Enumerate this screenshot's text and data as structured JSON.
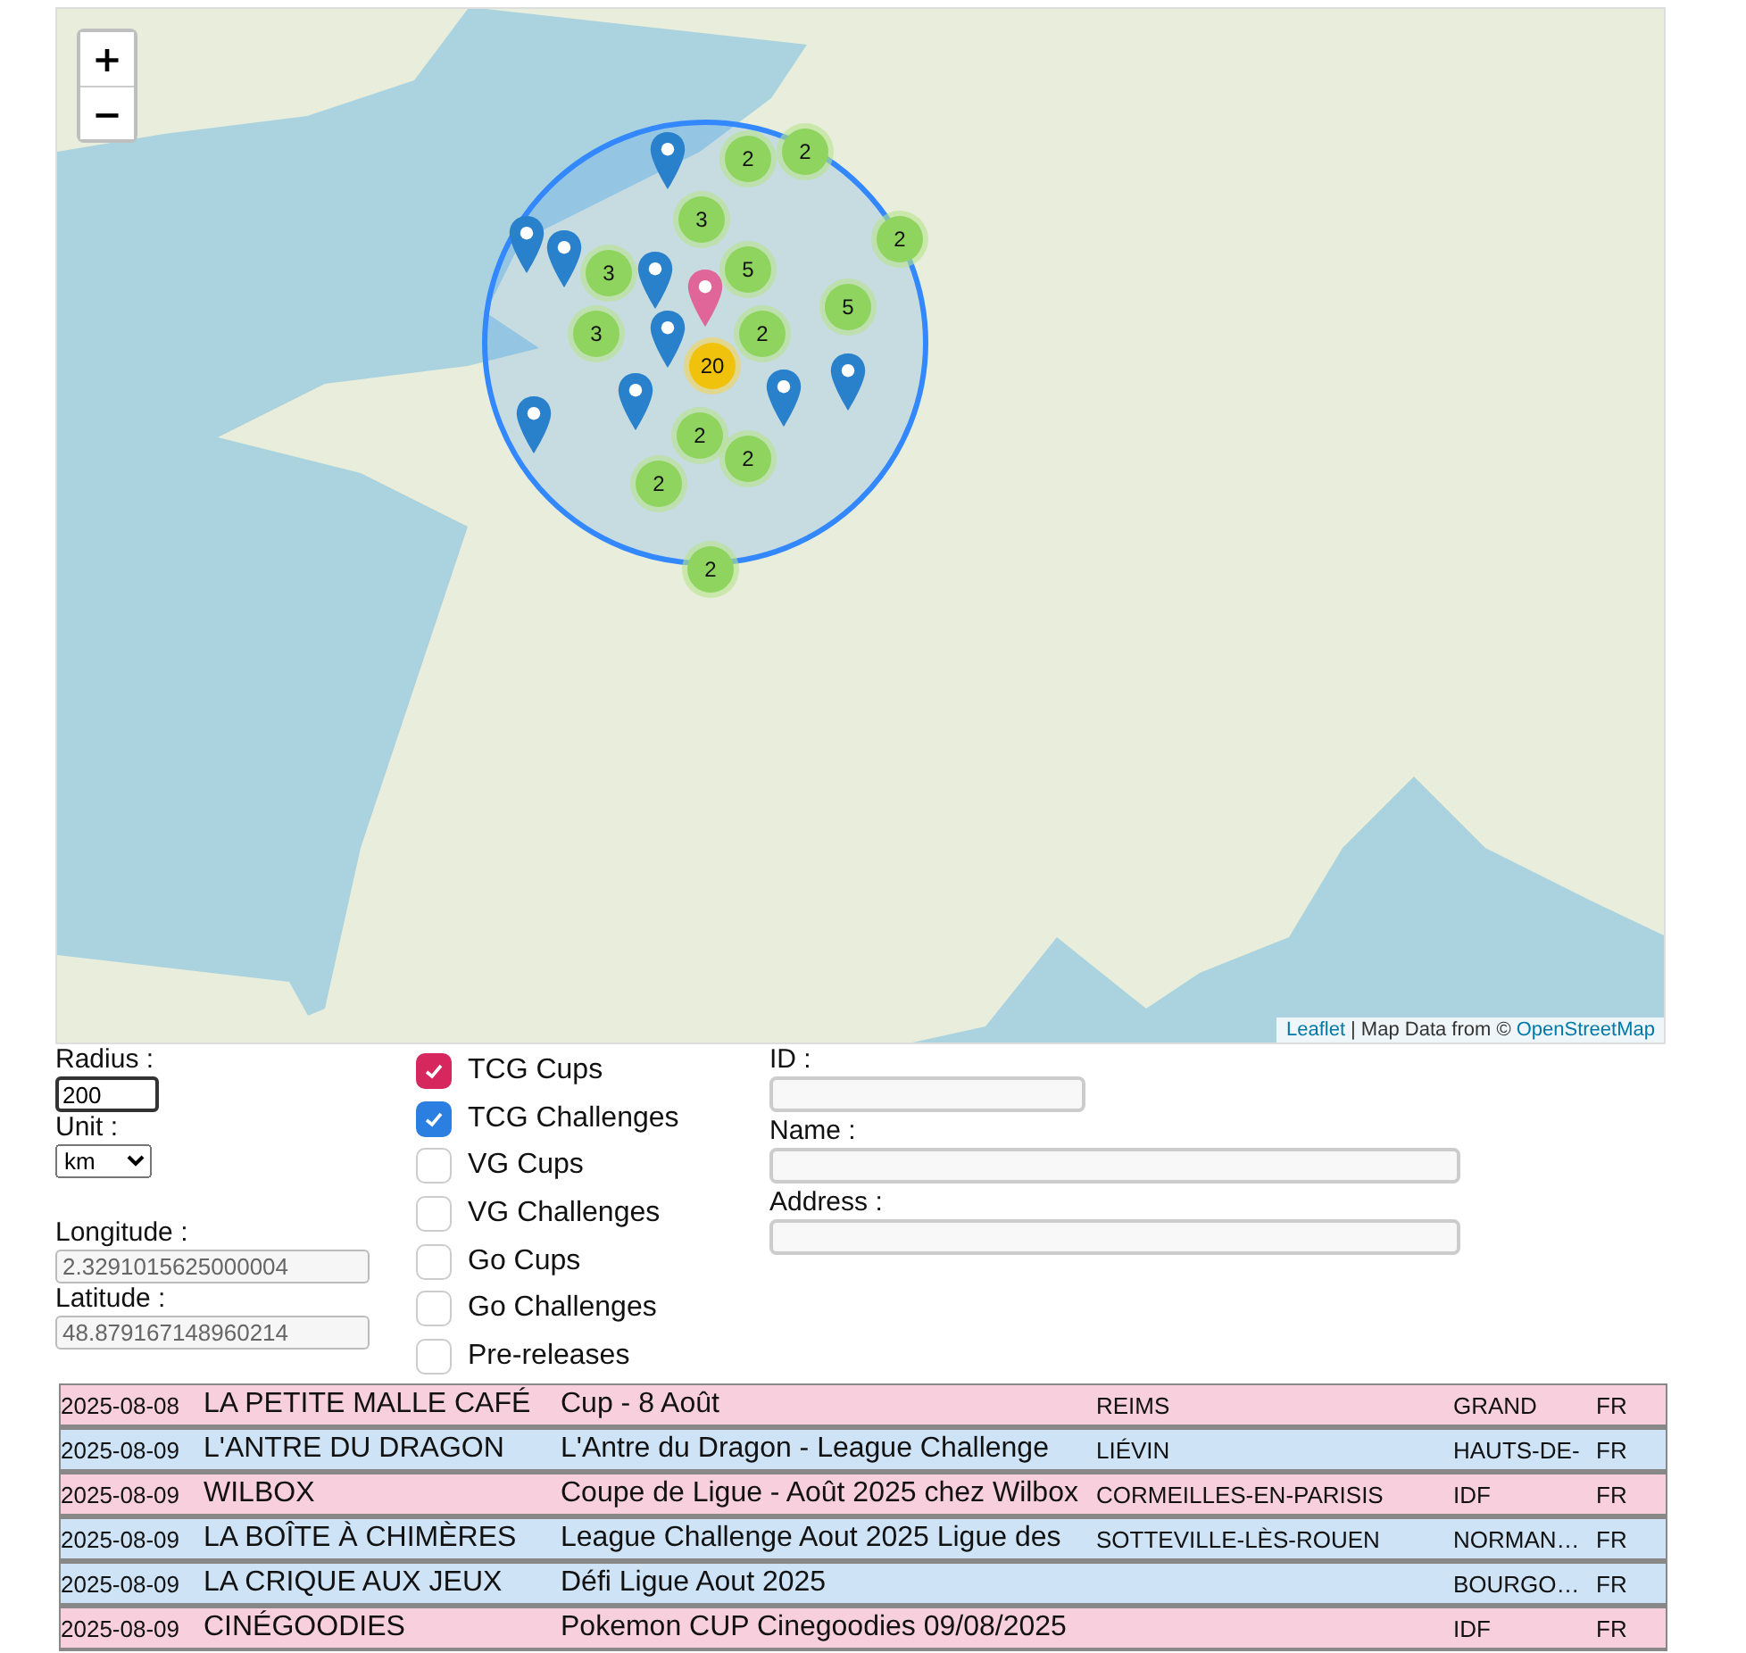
{
  "map": {
    "zoom_in": "+",
    "zoom_out": "−",
    "clusters": [
      {
        "count": "2",
        "kind": "small"
      },
      {
        "count": "2",
        "kind": "small"
      },
      {
        "count": "3",
        "kind": "small"
      },
      {
        "count": "2",
        "kind": "small"
      },
      {
        "count": "3",
        "kind": "small"
      },
      {
        "count": "5",
        "kind": "small"
      },
      {
        "count": "5",
        "kind": "small"
      },
      {
        "count": "3",
        "kind": "small"
      },
      {
        "count": "2",
        "kind": "small"
      },
      {
        "count": "20",
        "kind": "medium"
      },
      {
        "count": "2",
        "kind": "small"
      },
      {
        "count": "2",
        "kind": "small"
      },
      {
        "count": "2",
        "kind": "small"
      },
      {
        "count": "2",
        "kind": "small"
      }
    ],
    "markers": [
      {
        "color": "#2a81cb"
      },
      {
        "color": "#2a81cb"
      },
      {
        "color": "#2a81cb"
      },
      {
        "color": "#2a81cb"
      },
      {
        "color": "#2a81cb"
      },
      {
        "color": "#2a81cb"
      },
      {
        "color": "#2a81cb"
      },
      {
        "color": "#2a81cb"
      },
      {
        "color": "#2a81cb"
      },
      {
        "color": "#e0669a"
      }
    ],
    "attribution": {
      "leaflet": "Leaflet",
      "text": "| Map Data from ©",
      "osm": "OpenStreetMap"
    }
  },
  "form": {
    "radius_label": "Radius :",
    "radius": "200",
    "unit_label": "Unit :",
    "unit": "km",
    "longitude_label": "Longitude :",
    "longitude": "2.3291015625000004",
    "latitude_label": "Latitude :",
    "latitude": "48.879167148960214"
  },
  "filters": [
    {
      "label": "TCG Cups",
      "checked": true,
      "color": "#d6285f"
    },
    {
      "label": "TCG Challenges",
      "checked": true,
      "color": "#2b7fe0"
    },
    {
      "label": "VG Cups",
      "checked": false
    },
    {
      "label": "VG Challenges",
      "checked": false
    },
    {
      "label": "Go Cups",
      "checked": false
    },
    {
      "label": "Go Challenges",
      "checked": false
    },
    {
      "label": "Pre-releases",
      "checked": false
    }
  ],
  "search": {
    "id_label": "ID :",
    "name_label": "Name :",
    "address_label": "Address :"
  },
  "rows": [
    {
      "kind": "cup",
      "date": "2025-08-08",
      "store": "LA PETITE MALLE CAFÉ",
      "event": "Cup - 8 Août",
      "city": "REIMS",
      "region": "GRAND",
      "country": "FR"
    },
    {
      "kind": "challenge",
      "date": "2025-08-09",
      "store": "L'ANTRE DU DRAGON",
      "event": "L'Antre du Dragon - League Challenge",
      "city": "LIÉVIN",
      "region": "HAUTS-DE-",
      "country": "FR"
    },
    {
      "kind": "cup",
      "date": "2025-08-09",
      "store": "WILBOX",
      "event": "Coupe de Ligue - Août 2025 chez Wilbox",
      "city": "CORMEILLES-EN-PARISIS",
      "region": "IDF",
      "country": "FR"
    },
    {
      "kind": "challenge",
      "date": "2025-08-09",
      "store": "LA BOÎTE À CHIMÈRES",
      "event": "League Challenge Aout 2025 Ligue des",
      "city": "SOTTEVILLE-LÈS-ROUEN",
      "region": "NORMAN…",
      "country": "FR"
    },
    {
      "kind": "challenge",
      "date": "2025-08-09",
      "store": "LA CRIQUE AUX JEUX",
      "event": "Défi Ligue Aout 2025",
      "city": "",
      "region": "BOURGO…",
      "country": "FR"
    },
    {
      "kind": "cup",
      "date": "2025-08-09",
      "store": "CINÉGOODIES",
      "event": "Pokemon CUP Cinegoodies 09/08/2025",
      "city": "",
      "region": "IDF",
      "country": "FR"
    }
  ]
}
